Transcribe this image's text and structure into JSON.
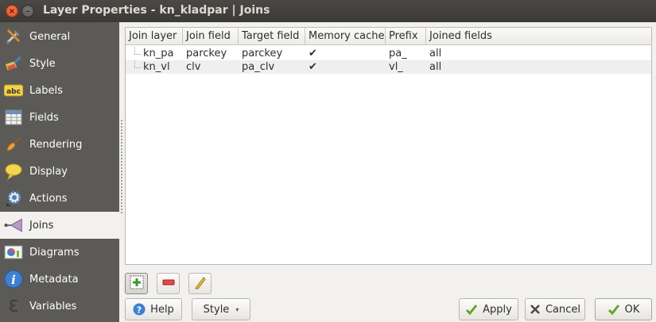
{
  "window": {
    "title": "Layer Properties - kn_kladpar | Joins",
    "close": "×",
    "minimize": "–"
  },
  "sidebar": {
    "items": [
      {
        "label": "General",
        "icon": "general-tools-icon"
      },
      {
        "label": "Style",
        "icon": "style-brush-icon"
      },
      {
        "label": "Labels",
        "icon": "labels-abc-icon"
      },
      {
        "label": "Fields",
        "icon": "fields-table-icon"
      },
      {
        "label": "Rendering",
        "icon": "rendering-brush-icon"
      },
      {
        "label": "Display",
        "icon": "display-bubble-icon"
      },
      {
        "label": "Actions",
        "icon": "actions-gear-icon"
      },
      {
        "label": "Joins",
        "icon": "joins-icon",
        "active": true
      },
      {
        "label": "Diagrams",
        "icon": "diagrams-icon"
      },
      {
        "label": "Metadata",
        "icon": "metadata-info-icon"
      },
      {
        "label": "Variables",
        "icon": "variables-epsilon-icon"
      }
    ]
  },
  "joins_table": {
    "headers": [
      "Join layer",
      "Join field",
      "Target field",
      "Memory cache",
      "Prefix",
      "Joined fields"
    ],
    "rows": [
      [
        "kn_pa",
        "parckey",
        "parckey",
        "✔",
        "pa_",
        "all"
      ],
      [
        "kn_vl",
        "clv",
        "pa_clv",
        "✔",
        "vl_",
        "all"
      ]
    ]
  },
  "toolbar": {
    "add": "add-join-icon",
    "remove": "remove-join-icon",
    "edit": "edit-join-icon"
  },
  "buttons": {
    "help": "Help",
    "style": "Style",
    "style_caret": "▾",
    "apply": "Apply",
    "cancel": "Cancel",
    "ok": "OK"
  },
  "colors": {
    "sidebar_bg": "#5b5a57",
    "titlebar_bg": "#3b3a37",
    "close_button": "#df4a16",
    "accent_green": "#3c9a2a"
  }
}
